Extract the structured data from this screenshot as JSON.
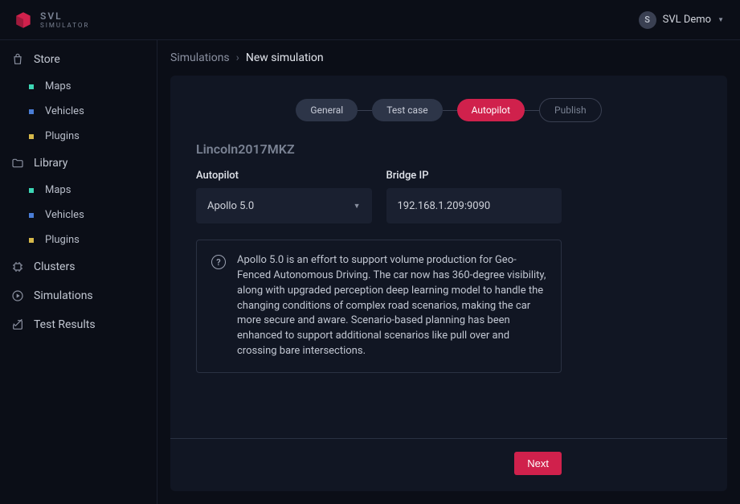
{
  "brand": {
    "line1": "SVL",
    "line2": "SIMULATOR"
  },
  "user": {
    "initial": "S",
    "name": "SVL Demo"
  },
  "sidebar": {
    "store": {
      "label": "Store",
      "maps": "Maps",
      "vehicles": "Vehicles",
      "plugins": "Plugins"
    },
    "library": {
      "label": "Library",
      "maps": "Maps",
      "vehicles": "Vehicles",
      "plugins": "Plugins"
    },
    "clusters": "Clusters",
    "simulations": "Simulations",
    "testResults": "Test Results"
  },
  "breadcrumb": {
    "parent": "Simulations",
    "current": "New simulation"
  },
  "steps": {
    "general": "General",
    "testcase": "Test case",
    "autopilot": "Autopilot",
    "publish": "Publish"
  },
  "form": {
    "title": "Lincoln2017MKZ",
    "autopilot_label": "Autopilot",
    "autopilot_value": "Apollo 5.0",
    "bridge_label": "Bridge IP",
    "bridge_value": "192.168.1.209:9090",
    "info": "Apollo 5.0 is an effort to support volume production for Geo-Fenced Autonomous Driving. The car now has 360-degree visibility, along with upgraded perception deep learning model to handle the changing conditions of complex road scenarios, making the car more secure and aware. Scenario-based planning has been enhanced to support additional scenarios like pull over and crossing bare intersections."
  },
  "buttons": {
    "next": "Next"
  }
}
